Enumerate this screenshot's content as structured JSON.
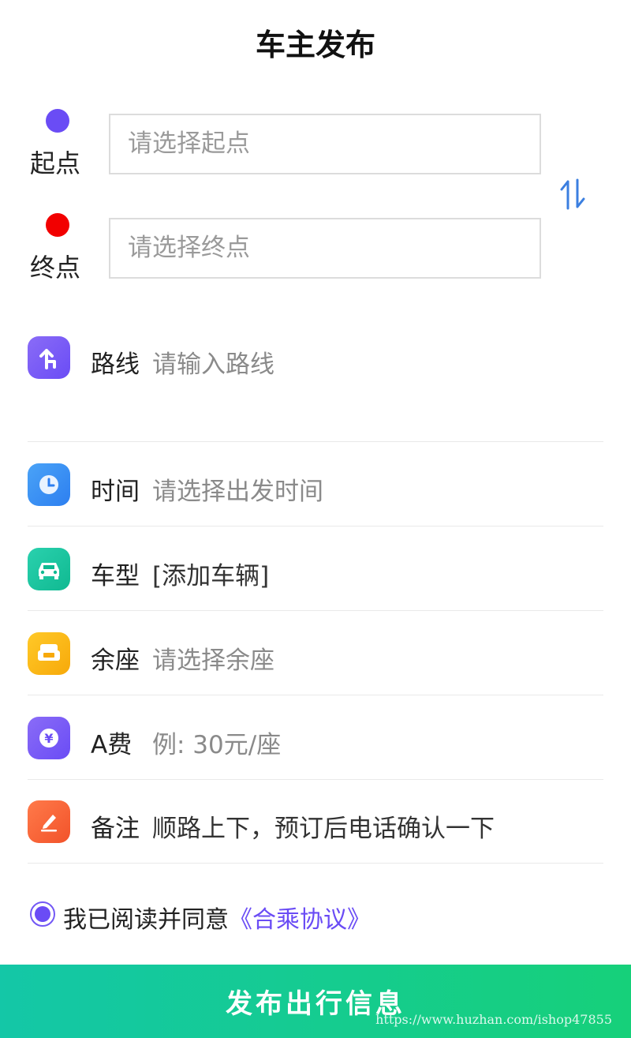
{
  "header": {
    "title": "车主发布"
  },
  "start": {
    "label": "起点",
    "placeholder": "请选择起点",
    "dot_color": "#6a4cf5"
  },
  "end": {
    "label": "终点",
    "placeholder": "请选择终点",
    "dot_color": "#f20000"
  },
  "swap_icon": "swap-vertical-arrows",
  "route": {
    "label": "路线",
    "placeholder": "请输入路线",
    "icon": "route-arrow-icon"
  },
  "time": {
    "label": "时间",
    "placeholder": "请选择出发时间",
    "icon": "clock-icon"
  },
  "car": {
    "label": "车型",
    "value": "[添加车辆]",
    "icon": "car-icon"
  },
  "seats": {
    "label": "余座",
    "placeholder": "请选择余座",
    "icon": "seat-icon"
  },
  "fee": {
    "label": "A费",
    "placeholder": "例: 30元/座",
    "icon": "yen-coin-icon"
  },
  "note": {
    "label": "备注",
    "value": "顺路上下，预订后电话确认一下",
    "icon": "edit-pencil-icon"
  },
  "agreement": {
    "text": "我已阅读并同意",
    "link": "《合乘协议》",
    "checked": true
  },
  "publish_button": {
    "label": "发布出行信息"
  },
  "watermark": "https://www.huzhan.com/ishop47855",
  "colors": {
    "accent": "#6a4cf5",
    "button_start": "#14c7a7",
    "button_end": "#16d07a"
  }
}
